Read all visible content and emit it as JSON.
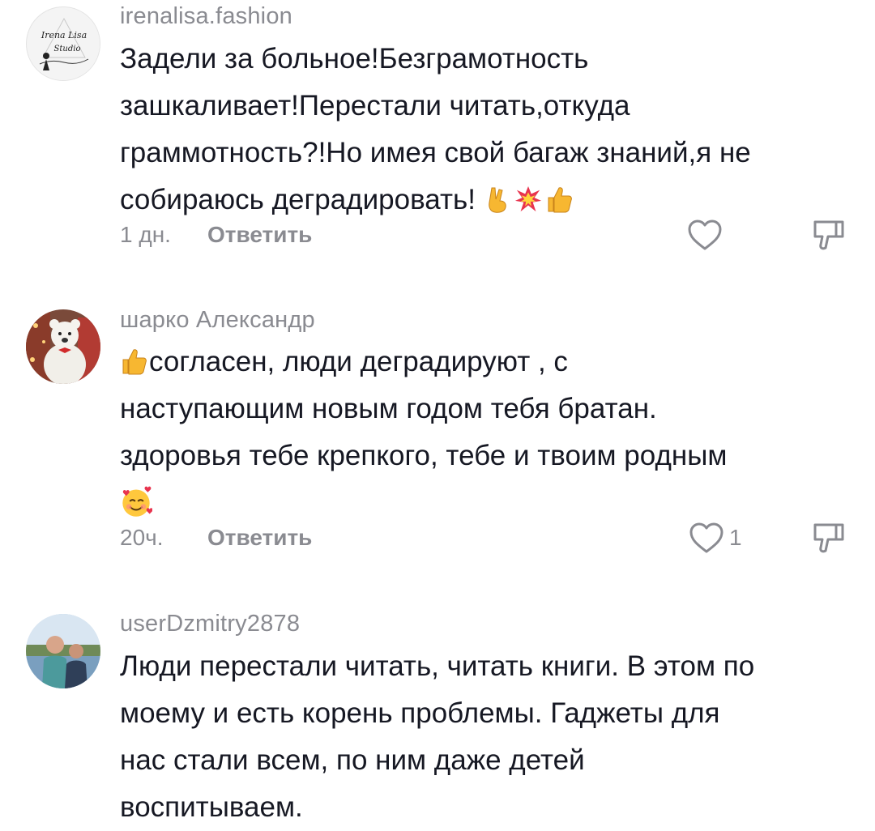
{
  "comments": [
    {
      "username": "irenalisa.fashion",
      "avatar_text_1": "Irena Lisa",
      "avatar_text_2": "Studio",
      "lines": [
        "Задели за больное!Безграмотность",
        "зашкаливает!Перестали читать,откуда",
        "граммотность?!Но имея свой багаж знаний,я не",
        "собираюсь деградировать!"
      ],
      "trailing_emojis": [
        "victory-hand-emoji",
        "collision-emoji",
        "thumbs-up-emoji"
      ],
      "time": "1 дн.",
      "reply_label": "Ответить",
      "like_count": ""
    },
    {
      "username": "шарко Александр",
      "lines": [
        "согласен, люди деградируют , с",
        "наступающим новым годом тебя братан.",
        "здоровья тебе крепкого, тебе и твоим родным"
      ],
      "leading_emoji": "thumbs-up-emoji",
      "last_line_emoji": "smiling-face-with-hearts-emoji",
      "time": "20ч.",
      "reply_label": "Ответить",
      "like_count": "1"
    },
    {
      "username": "userDzmitry2878",
      "lines": [
        "Люди перестали читать, читать книги. В этом по",
        "моему и есть корень проблемы. Гаджеты для",
        "нас стали всем, по ним даже детей",
        "воспитываем."
      ]
    }
  ],
  "colors": {
    "text": "#161823",
    "secondary": "#8a8b91",
    "background": "#ffffff"
  }
}
